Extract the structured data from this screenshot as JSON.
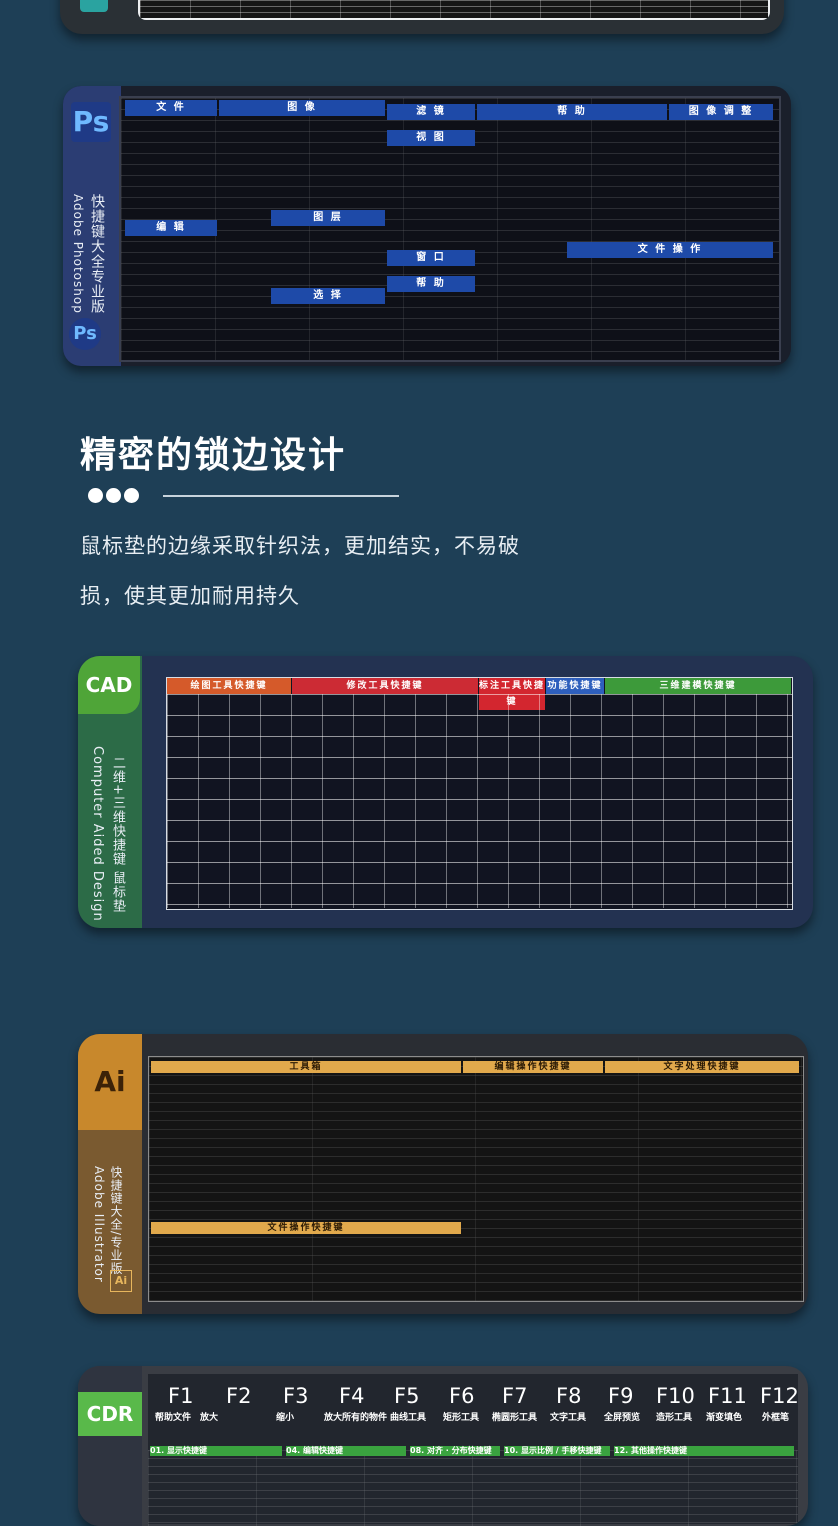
{
  "photoshop_pad": {
    "logo": "Ps",
    "side_title_cn": "快捷键大全专业版",
    "side_title_en": "Adobe Photoshop",
    "sections": [
      "文 件",
      "图 像",
      "滤 镜",
      "帮 助",
      "图 像 调 整",
      "编 辑",
      "视 图",
      "图 层",
      "窗 口",
      "文 件 操 作",
      "选 择",
      "帮 助"
    ],
    "colors": {
      "frame": "#2b3d73",
      "header": "#1e4aa8"
    }
  },
  "feature": {
    "title": "精密的锁边设计",
    "description_line1": "鼠标垫的边缘采取针织法，更加结实，不易破",
    "description_line2": "损，使其更加耐用持久"
  },
  "cad_pad": {
    "logo": "CAD",
    "side_title_cn": "二维+三维快捷键 鼠标垫",
    "side_title_en": "Computer Aided Design",
    "sections": [
      "绘图工具快捷键",
      "修改工具快捷键",
      "标注工具快捷键",
      "功能快捷键",
      "三维建模快捷键"
    ],
    "colors": {
      "logo_bg": "#4fa538",
      "draw": "#d55a2a",
      "modify": "#cc2b34",
      "dim": "#d3262f",
      "func": "#2e5fbd",
      "model": "#3d9a3a"
    }
  },
  "ai_pad": {
    "logo": "Ai",
    "side_title_cn": "快捷键大全/专业版",
    "side_title_en": "Adobe Illustrator",
    "sections": [
      "工具箱",
      "编辑操作快捷键",
      "文字处理快捷键",
      "文件操作快捷键"
    ],
    "colors": {
      "logo_bg": "#c8882c",
      "header": "#e1a94c"
    }
  },
  "cdr_pad": {
    "logo": "CDR",
    "function_keys": [
      "F1",
      "F2",
      "F3",
      "F4",
      "F5",
      "F6",
      "F7",
      "F8",
      "F9",
      "F10",
      "F11",
      "F12"
    ],
    "function_labels": [
      "帮助文件",
      "放大",
      "缩小",
      "放大所有的物件",
      "曲线工具",
      "矩形工具",
      "椭圆形工具",
      "文字工具",
      "全屏预览",
      "造形工具",
      "渐变填色",
      "外框笔"
    ],
    "sections": [
      "01. 显示快捷键",
      "04. 编辑快捷键",
      "08. 对齐 · 分布快捷键",
      "10. 显示比例 / 手移快捷键",
      "12. 其他操作快捷键"
    ],
    "colors": {
      "logo_bg": "#59b94a",
      "section": "#3aa33f"
    }
  }
}
